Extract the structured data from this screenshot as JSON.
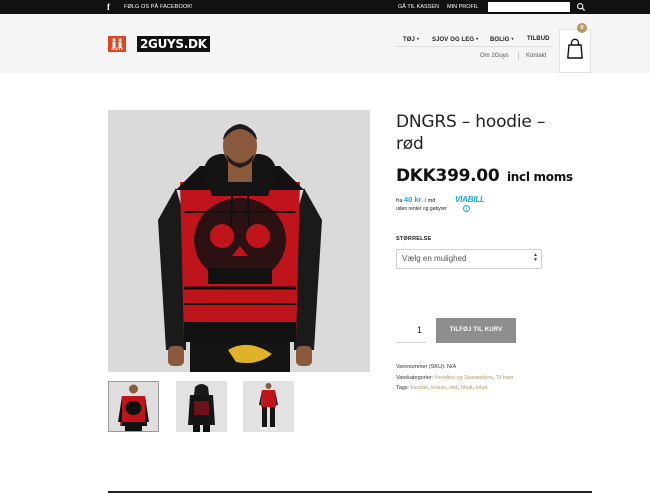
{
  "topbar": {
    "facebook_icon": "f",
    "facebook_text": "FØLG OS PÅ FACEBOOK!",
    "checkout": "GÅ TIL KASSEN",
    "profile": "MIN PROFIL",
    "search_placeholder": "",
    "search_icon": "search-icon"
  },
  "header": {
    "logo_mini": "2GUYS",
    "logo_text": "2GUYS.DK",
    "nav": [
      {
        "label": "TØJ",
        "dropdown": true
      },
      {
        "label": "SJOV OG LEG",
        "dropdown": true
      },
      {
        "label": "BOLIG",
        "dropdown": true
      },
      {
        "label": "TILBUD",
        "dropdown": false
      }
    ],
    "subnav": [
      "Om 2Guys",
      "Kontakt"
    ],
    "cart_count": "0",
    "cart_icon": "shopping-bag-icon"
  },
  "product": {
    "title": "DNGRS – hoodie – rød",
    "price": "DKK399.00",
    "tax_label": "incl moms",
    "viabill": {
      "prefix": "fra",
      "amount": "40 kr.",
      "suffix": "/ md",
      "line2": "uden renter og gebyrer",
      "logo": "VIABILL",
      "info": "i"
    },
    "size_label": "STØRRELSE",
    "size_placeholder": "Vælg en mulighed",
    "quantity": "1",
    "add_to_cart": "TILFØJ TIL KURV",
    "sku_label": "Varenummer (SKU):",
    "sku_value": "N/A",
    "categories_label": "Varekategorier:",
    "categories": [
      "Hoodies og Sweatshirts",
      "Til ham"
    ],
    "tags_label": "Tags:",
    "tags": [
      "Hoodie",
      "kranie",
      "rød",
      "Skull",
      "tekst"
    ]
  },
  "colors": {
    "accent": "#b79a63",
    "brand_red": "#e2441d",
    "viabill_blue": "#1aa7d6",
    "button_gray": "#8e8e8e"
  }
}
